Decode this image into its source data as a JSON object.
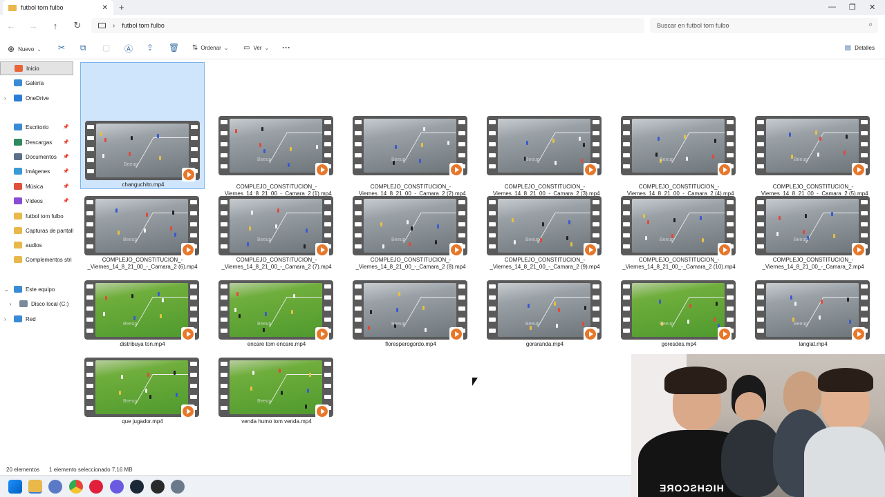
{
  "window": {
    "tab_title": "futbol tom fulbo",
    "close_tab": "✕",
    "new_tab": "+"
  },
  "address": {
    "path": "futbol tom fulbo",
    "search_placeholder": "Buscar en futbol tom fulbo"
  },
  "toolbar": {
    "new_label": "Nuevo",
    "sort_label": "Ordenar",
    "view_label": "Ver",
    "more_label": "···",
    "details_label": "Detalles"
  },
  "sidebar": {
    "items": [
      {
        "label": "Inicio",
        "icon": "home-icon",
        "color": "#e8643a"
      },
      {
        "label": "Galería",
        "icon": "gallery-icon",
        "color": "#3a8ad6"
      },
      {
        "label": "OneDrive",
        "icon": "cloud-icon",
        "color": "#2a7ed6"
      },
      {
        "label": "Escritorio",
        "icon": "desktop-icon",
        "color": "#3a8ad6"
      },
      {
        "label": "Descargas",
        "icon": "download-icon",
        "color": "#2e8a5e"
      },
      {
        "label": "Documentos",
        "icon": "document-icon",
        "color": "#5a6f8a"
      },
      {
        "label": "Imágenes",
        "icon": "image-icon",
        "color": "#3a9ad6"
      },
      {
        "label": "Música",
        "icon": "music-icon",
        "color": "#e0503a"
      },
      {
        "label": "Vídeos",
        "icon": "video-icon",
        "color": "#8a4ad6"
      },
      {
        "label": "futbol tom fulbo",
        "icon": "folder-icon",
        "color": "#e8b84a"
      },
      {
        "label": "Capturas de pantall",
        "icon": "folder-icon",
        "color": "#e8b84a"
      },
      {
        "label": "audios",
        "icon": "folder-icon",
        "color": "#e8b84a"
      },
      {
        "label": "Complementos stri",
        "icon": "folder-icon",
        "color": "#e8b84a"
      },
      {
        "label": "Este equipo",
        "icon": "computer-icon",
        "color": "#3a8ad6"
      },
      {
        "label": "Disco local (C:)",
        "icon": "drive-icon",
        "color": "#7a8a9a"
      },
      {
        "label": "Red",
        "icon": "network-icon",
        "color": "#3a8ad6"
      }
    ]
  },
  "files": [
    {
      "name": "changuchito.mp4",
      "thumb": "gray"
    },
    {
      "name": "COMPLEJO_CONSTITUCION_-_Viernes_14_8_21_00_-_Camara_2 (1).mp4",
      "thumb": "gray"
    },
    {
      "name": "COMPLEJO_CONSTITUCION_-_Viernes_14_8_21_00_-_Camara_2 (2).mp4",
      "thumb": "gray"
    },
    {
      "name": "COMPLEJO_CONSTITUCION_-_Viernes_14_8_21_00_-_Camara_2 (3).mp4",
      "thumb": "gray"
    },
    {
      "name": "COMPLEJO_CONSTITUCION_-_Viernes_14_8_21_00_-_Camara_2 (4).mp4",
      "thumb": "gray"
    },
    {
      "name": "COMPLEJO_CONSTITUCION_-_Viernes_14_8_21_00_-_Camara_2 (5).mp4",
      "thumb": "gray"
    },
    {
      "name": "COMPLEJO_CONSTITUCION_-_Viernes_14_8_21_00_-_Camara_2 (6).mp4",
      "thumb": "gray"
    },
    {
      "name": "COMPLEJO_CONSTITUCION_-_Viernes_14_8_21_00_-_Camara_2 (7).mp4",
      "thumb": "gray"
    },
    {
      "name": "COMPLEJO_CONSTITUCION_-_Viernes_14_8_21_00_-_Camara_2 (8).mp4",
      "thumb": "gray"
    },
    {
      "name": "COMPLEJO_CONSTITUCION_-_Viernes_14_8_21_00_-_Camara_2 (9).mp4",
      "thumb": "gray"
    },
    {
      "name": "COMPLEJO_CONSTITUCION_-_Viernes_14_8_21_00_-_Camara_2 (10).mp4",
      "thumb": "gray"
    },
    {
      "name": "COMPLEJO_CONSTITUCION_-_Viernes_14_8_21_00_-_Camara_2.mp4",
      "thumb": "gray"
    },
    {
      "name": "distribuya ton.mp4",
      "thumb": "green"
    },
    {
      "name": "encare tom encare.mp4",
      "thumb": "green"
    },
    {
      "name": "floresperogordo.mp4",
      "thumb": "gray"
    },
    {
      "name": "goraranda.mp4",
      "thumb": "gray"
    },
    {
      "name": "goresdes.mp4",
      "thumb": "green"
    },
    {
      "name": "langlat.mp4",
      "thumb": "gray"
    },
    {
      "name": "que jugador.mp4",
      "thumb": "green"
    },
    {
      "name": "venda humo tom venda.mp4",
      "thumb": "green"
    }
  ],
  "watermark": "Beeup",
  "status": {
    "count": "20 elementos",
    "selection": "1 elemento seleccionado  7,16 MB"
  },
  "webcam": {
    "shirt_text": "HIGHSCORE"
  }
}
